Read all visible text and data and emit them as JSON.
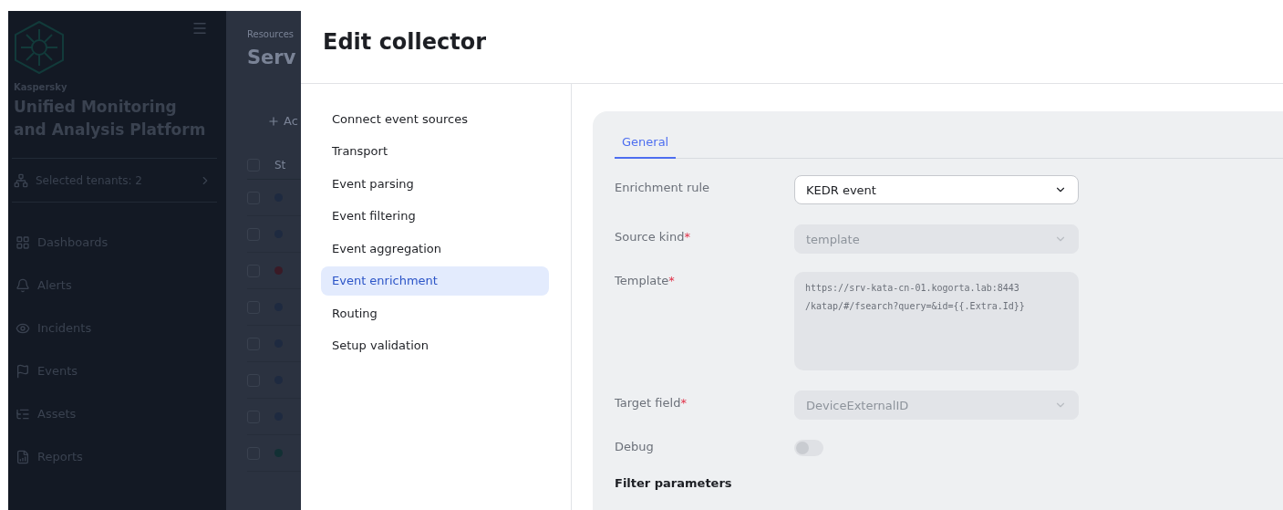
{
  "sidebar": {
    "brand": "Kaspersky",
    "product": "Unified Monitoring and Analysis Platform",
    "tenants": "Selected tenants: 2",
    "items": [
      {
        "label": "Dashboards"
      },
      {
        "label": "Alerts"
      },
      {
        "label": "Incidents"
      },
      {
        "label": "Events"
      },
      {
        "label": "Assets"
      },
      {
        "label": "Reports"
      }
    ]
  },
  "background_page": {
    "breadcrumb": "Resources",
    "title": "Serv",
    "add_button": "Ac",
    "column_header": "St",
    "select_all_checked": false,
    "rows": [
      {
        "color": "#1e2a40",
        "checked": false
      },
      {
        "color": "#1e2a40",
        "checked": false
      },
      {
        "color": "#3a1a26",
        "checked": false
      },
      {
        "color": "#1e2a40",
        "checked": false
      },
      {
        "color": "#1e2a40",
        "checked": false
      },
      {
        "color": "#1e2a40",
        "checked": false
      },
      {
        "color": "#1e2a40",
        "checked": false
      },
      {
        "color": "#123034",
        "checked": false
      }
    ]
  },
  "dialog": {
    "title": "Edit collector",
    "steps": [
      {
        "label": "Connect event sources",
        "selected": false
      },
      {
        "label": "Transport",
        "selected": false
      },
      {
        "label": "Event parsing",
        "selected": false
      },
      {
        "label": "Event filtering",
        "selected": false
      },
      {
        "label": "Event aggregation",
        "selected": false
      },
      {
        "label": "Event enrichment",
        "selected": true
      },
      {
        "label": "Routing",
        "selected": false
      },
      {
        "label": "Setup validation",
        "selected": false
      }
    ],
    "tabs": [
      {
        "label": "General",
        "selected": true
      }
    ],
    "fields": [
      {
        "kind": "select",
        "label": "Enrichment rule",
        "disabled": false,
        "value": "KEDR event"
      },
      {
        "kind": "select",
        "label": "Source kind",
        "required_mark": "*",
        "disabled": true,
        "value": "template"
      },
      {
        "kind": "textarea",
        "label": "Template",
        "required_mark": "*",
        "disabled": true,
        "value": "https://srv-kata-cn-01.kogorta.lab:8443\n/katap/#/fsearch?query=&id={{.Extra.Id}}"
      },
      {
        "kind": "select",
        "label": "Target field",
        "required_mark": "*",
        "disabled": true,
        "value": "DeviceExternalID"
      },
      {
        "kind": "toggle",
        "label": "Debug",
        "on": false
      }
    ],
    "section_heading": "Filter parameters"
  }
}
